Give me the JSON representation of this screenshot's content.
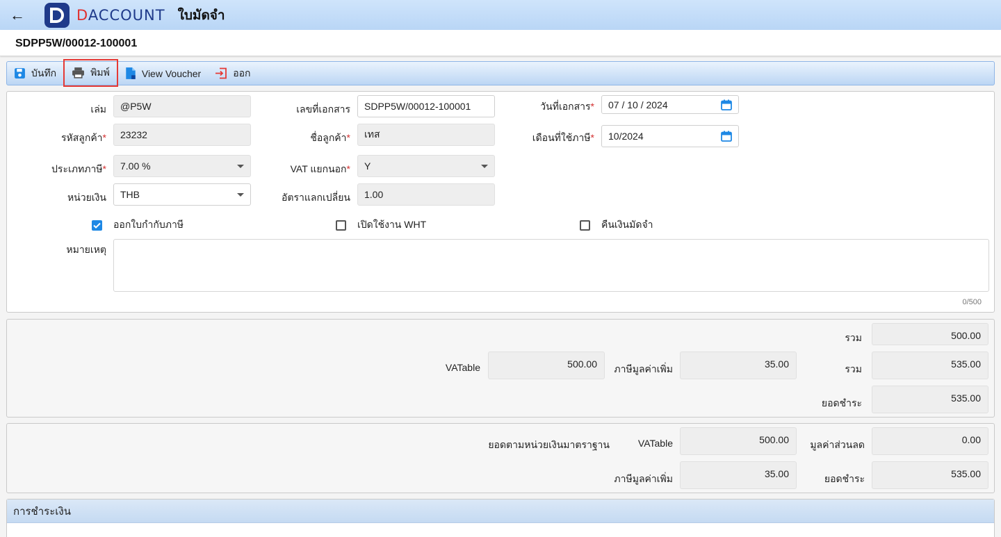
{
  "header": {
    "app_name_part1": "D",
    "app_name_part2": "ACCOUNT",
    "page_title": "ใบมัดจำ"
  },
  "document": {
    "number": "SDPP5W/00012-100001"
  },
  "toolbar": {
    "save_label": "บันทึก",
    "print_label": "พิมพ์",
    "voucher_label": "View Voucher",
    "exit_label": "ออก"
  },
  "form": {
    "book_label": "เล่ม",
    "book_value": "@P5W",
    "docno_label": "เลขที่เอกสาร",
    "docno_value": "SDPP5W/00012-100001",
    "docdate_label": "วันที่เอกสาร",
    "docdate_value": "07 / 10 /  2024",
    "custcode_label": "รหัสลูกค้า",
    "custcode_value": "23232",
    "custname_label": "ชื่อลูกค้า",
    "custname_value": "เทส",
    "taxmonth_label": "เดือนที่ใช้ภาษี",
    "taxmonth_value": "10/2024",
    "taxtype_label": "ประเภทภาษี",
    "taxtype_value": "7.00 %",
    "vatsep_label": "VAT แยกนอก",
    "vatsep_value": "Y",
    "currency_label": "หน่วยเงิน",
    "currency_value": "THB",
    "rate_label": "อัตราแลกเปลี่ยน",
    "rate_value": "1.00",
    "issue_tax_invoice_label": "ออกใบกำกับภาษี",
    "issue_tax_invoice_checked": true,
    "wht_label": "เปิดใช้งาน WHT",
    "wht_checked": false,
    "refund_label": "คืนเงินมัดจำ",
    "refund_checked": false,
    "remark_label": "หมายเหตุ",
    "remark_value": "",
    "remark_counter": "0/500"
  },
  "totals": {
    "sum_label": "รวม",
    "sum_value": "500.00",
    "vatable_label": "VATable",
    "vatable_value": "500.00",
    "vat_label": "ภาษีมูลค่าเพิ่ม",
    "vat_value": "35.00",
    "sum2_label": "รวม",
    "sum2_value": "535.00",
    "pay_label": "ยอดชำระ",
    "pay_value": "535.00"
  },
  "base_currency": {
    "title": "ยอดตามหน่วยเงินมาตราฐาน",
    "vatable_label": "VATable",
    "vatable_value": "500.00",
    "discount_label": "มูลค่าส่วนลด",
    "discount_value": "0.00",
    "vat_label": "ภาษีมูลค่าเพิ่ม",
    "vat_value": "35.00",
    "pay_label": "ยอดชำระ",
    "pay_value": "535.00"
  },
  "payment": {
    "title": "การชำระเงิน"
  },
  "colors": {
    "accent": "#1e88e5",
    "header_bg": "#cfe4fb",
    "logo_blue": "#1f3a8a",
    "logo_red": "#e0302e",
    "highlight_red": "#e53935"
  }
}
